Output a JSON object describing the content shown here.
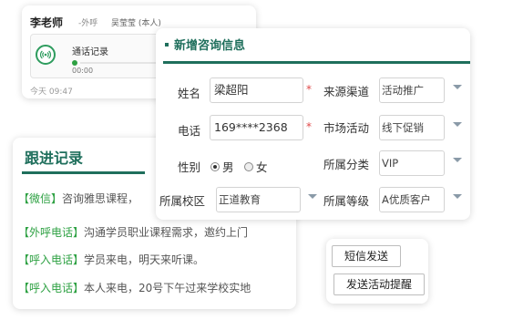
{
  "call_card": {
    "caller_name": "李老师",
    "call_type": "-外呼",
    "person": "吴莹莹 (本人)",
    "record_label": "通话记录",
    "record_time": "00:00",
    "time": "今天 09:47"
  },
  "consult_form": {
    "title": "新增咨询信息",
    "name": {
      "label": "姓名",
      "value": "梁超阳",
      "required": "*"
    },
    "source": {
      "label": "来源渠道",
      "value": "活动推广"
    },
    "phone": {
      "label": "电话",
      "value": "169****2368",
      "required": "*"
    },
    "campaign": {
      "label": "市场活动",
      "value": "线下促销"
    },
    "gender": {
      "label": "性别",
      "options": [
        "男",
        "女"
      ],
      "selected": "男"
    },
    "category": {
      "label": "所属分类",
      "value": "VIP"
    },
    "campus": {
      "label": "所属校区",
      "value": "正道教育"
    },
    "level": {
      "label": "所属等级",
      "value": "A优质客户"
    }
  },
  "followup": {
    "title": "跟进记录",
    "records": [
      {
        "tag": "【微信】",
        "text": "咨询雅思课程，"
      },
      {
        "tag": "【外呼电话】",
        "text": "沟通学员职业课程需求，邀约上门"
      },
      {
        "tag": "【呼入电话】",
        "text": "学员来电，明天来听课。"
      },
      {
        "tag": "【呼入电话】",
        "text": "本人来电，20号下午过来学校实地"
      }
    ]
  },
  "actions": {
    "sms_label": "短信发送",
    "reminder_label": "发送活动提醒"
  },
  "colors": {
    "accent": "#1f6f5c",
    "tag": "#2ea143",
    "required": "#e04a4a"
  }
}
